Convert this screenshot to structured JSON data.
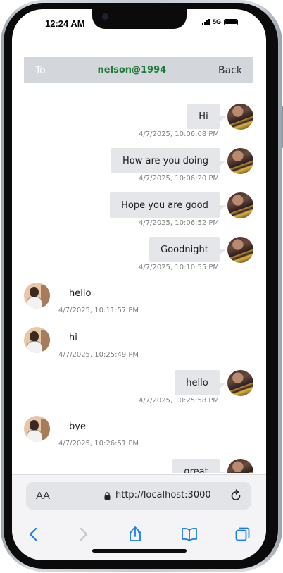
{
  "status_bar": {
    "time": "12:24 AM",
    "network": "5G"
  },
  "header": {
    "to_label": "To",
    "recipient": "nelson@1994",
    "back_label": "Back"
  },
  "messages": [
    {
      "direction": "outgoing",
      "text": "Hi",
      "timestamp": "4/7/2025, 10:06:08 PM"
    },
    {
      "direction": "outgoing",
      "text": "How are you doing",
      "timestamp": "4/7/2025, 10:06:20 PM"
    },
    {
      "direction": "outgoing",
      "text": "Hope you are good",
      "timestamp": "4/7/2025, 10:06:52 PM"
    },
    {
      "direction": "outgoing",
      "text": "Goodnight",
      "timestamp": "4/7/2025, 10:10:55 PM"
    },
    {
      "direction": "incoming",
      "text": "hello",
      "timestamp": "4/7/2025, 10:11:57 PM"
    },
    {
      "direction": "incoming",
      "text": "hi",
      "timestamp": "4/7/2025, 10:25:49 PM"
    },
    {
      "direction": "outgoing",
      "text": "hello",
      "timestamp": "4/7/2025, 10:25:58 PM"
    },
    {
      "direction": "incoming",
      "text": "bye",
      "timestamp": "4/7/2025, 10:26:51 PM"
    },
    {
      "direction": "outgoing",
      "text": "great",
      "timestamp": ""
    }
  ],
  "browser": {
    "text_size_label": "AA",
    "url": "http://localhost:3000",
    "icons": [
      "lock-icon",
      "reload-icon",
      "back-icon",
      "forward-icon",
      "share-icon",
      "bookmarks-icon",
      "tabs-icon"
    ]
  },
  "colors": {
    "accent": "#1e7a37",
    "header_bg": "#d3d7dc",
    "bubble_bg": "#e4e6e9",
    "safari_blue": "#1a7cf5"
  }
}
